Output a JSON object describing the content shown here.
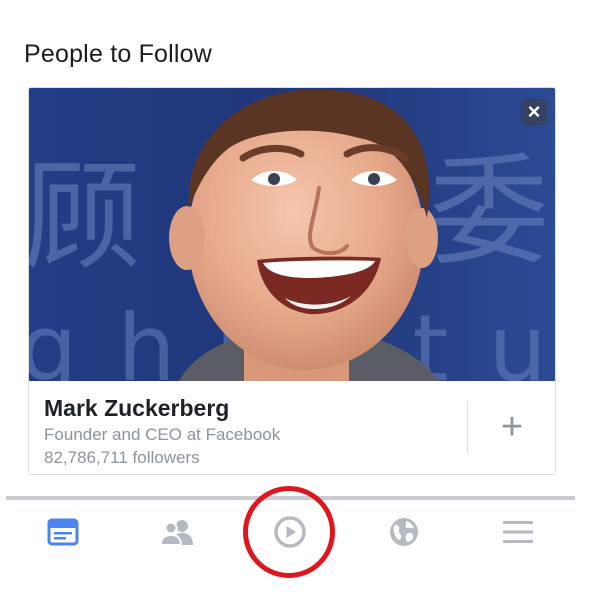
{
  "section": {
    "title": "People to Follow"
  },
  "card": {
    "name": "Mark Zuckerberg",
    "subtitle": "Founder and CEO at Facebook",
    "followers": "82,786,711 followers",
    "close_glyph": "×",
    "follow_glyph": "+"
  },
  "photo": {
    "background_chars": [
      "顾",
      "委"
    ],
    "background_latin": "ghuStu"
  },
  "tabbar": {
    "items": [
      {
        "name": "news-feed",
        "icon": "news-feed-icon",
        "active": true
      },
      {
        "name": "friends",
        "icon": "friends-icon",
        "active": false
      },
      {
        "name": "video",
        "icon": "play-icon",
        "active": false
      },
      {
        "name": "notifications",
        "icon": "globe-icon",
        "active": false
      },
      {
        "name": "menu",
        "icon": "menu-icon",
        "active": false
      }
    ]
  },
  "colors": {
    "active_tab": "#4a84f0",
    "inactive_tab": "#b5b9c1",
    "highlight_ring": "#e0161d",
    "muted_text": "#8d949e"
  }
}
